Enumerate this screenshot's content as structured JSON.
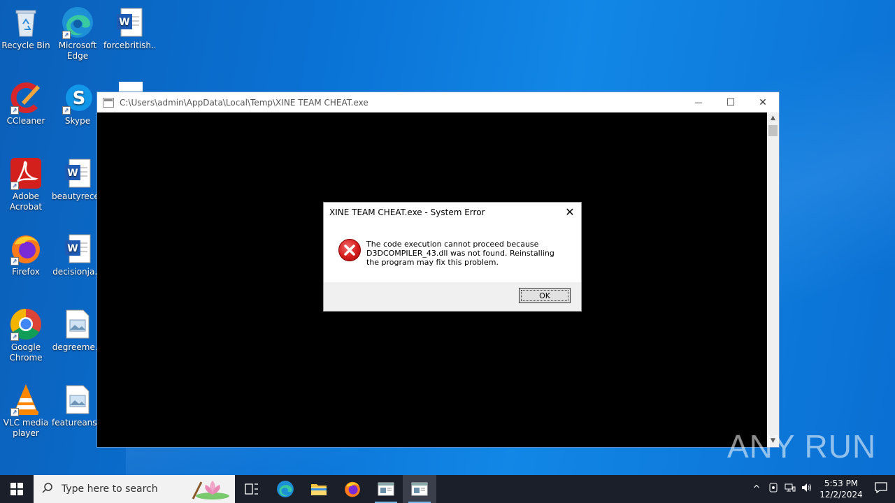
{
  "desktop": {
    "icons": [
      {
        "label": "Recycle Bin",
        "icon": "recycle-bin-icon"
      },
      {
        "label": "Microsoft Edge",
        "icon": "edge-icon"
      },
      {
        "label": "forcebritish...",
        "icon": "word-doc-icon"
      },
      {
        "label": "CCleaner",
        "icon": "ccleaner-icon"
      },
      {
        "label": "Skype",
        "icon": "skype-icon"
      },
      {
        "label": "Adobe Acrobat",
        "icon": "acrobat-icon"
      },
      {
        "label": "beautyrece...",
        "icon": "word-doc-icon"
      },
      {
        "label": "Firefox",
        "icon": "firefox-icon"
      },
      {
        "label": "decisionja...",
        "icon": "word-doc-icon"
      },
      {
        "label": "Google Chrome",
        "icon": "chrome-icon"
      },
      {
        "label": "degreeme...",
        "icon": "image-file-icon"
      },
      {
        "label": "VLC media player",
        "icon": "vlc-icon"
      },
      {
        "label": "featureans...",
        "icon": "image-file-icon"
      }
    ]
  },
  "console_window": {
    "title": "C:\\Users\\admin\\AppData\\Local\\Temp\\XINE TEAM CHEAT.exe",
    "minimize_glyph": "—",
    "maximize_glyph": "☐",
    "close_glyph": "✕"
  },
  "error_dialog": {
    "title": "XINE TEAM CHEAT.exe - System Error",
    "message": "The code execution cannot proceed because D3DCOMPILER_43.dll was not found. Reinstalling the program may fix this problem.",
    "ok_label": "OK",
    "close_glyph": "✕"
  },
  "watermark": "ANY RUN",
  "taskbar": {
    "search_placeholder": "Type here to search",
    "time": "5:53 PM",
    "date": "12/2/2024"
  }
}
